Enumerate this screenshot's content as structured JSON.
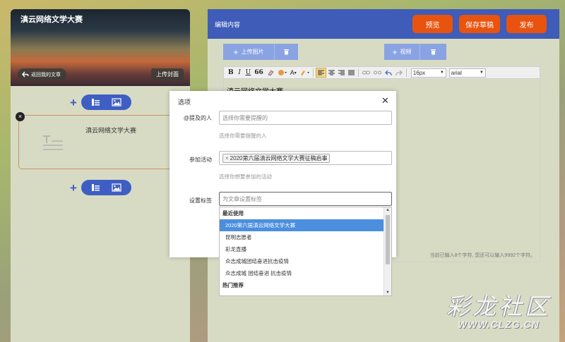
{
  "colors": {
    "brand_blue": "#3e5cb8",
    "accent_orange": "#e8530f",
    "highlight": "#4b8ede"
  },
  "left": {
    "cover_title": "滇云网络文学大赛",
    "back_label": "返回我的文章",
    "upload_cover_label": "上传封面",
    "card_title": "滇云网络文学大赛",
    "add_icon": "plus-icon",
    "text_icon": "text-block-icon",
    "image_icon": "image-icon"
  },
  "editor": {
    "header_title": "编辑内容",
    "preview_label": "预览",
    "save_draft_label": "保存草稿",
    "publish_label": "发布",
    "upload_image_label": "上传图片",
    "video_label": "视频",
    "font_size": "16px",
    "font_family": "arial",
    "heading": "滇云网络文学大赛",
    "char_count": "当前已输入8个字符, 您还可以输入9992个字符。"
  },
  "toolbar": {
    "items": [
      "B",
      "I",
      "U",
      "66"
    ]
  },
  "modal": {
    "title": "选项",
    "mention_label": "@提及的人",
    "mention_placeholder": "选择你需要提醒的",
    "mention_hint": "选择你需要提醒的人",
    "activity_label": "参加活动",
    "activity_tag": "2020第六届滇云网络文学大赛征稿启事",
    "activity_hint": "选择你想要参加的活动",
    "tag_label": "设置标签",
    "tag_placeholder": "为文章设置标签",
    "dropdown": {
      "recent_header": "最近使用",
      "recent_items": [
        "2020第六届滇云网络文学大赛",
        "昆明志愿者",
        "彩龙直播",
        "众志成城团结奋进抗击疫情",
        "众志成城 团结奋进 抗击疫情"
      ],
      "hot_header": "热门推荐"
    }
  },
  "watermark": {
    "name": "彩龙社区",
    "url": "WWW.CLZG.CN"
  }
}
